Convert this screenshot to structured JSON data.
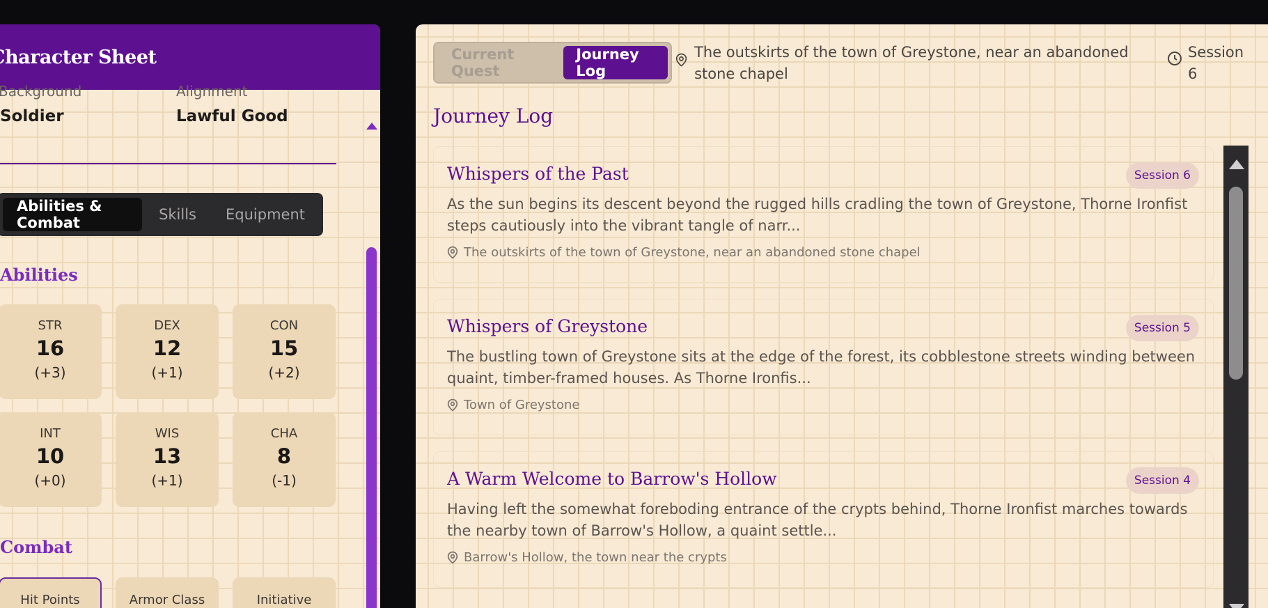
{
  "character_sheet": {
    "title": "Character Sheet",
    "background_label": "Background",
    "background_value": "Soldier",
    "alignment_label": "Alignment",
    "alignment_value": "Lawful Good",
    "tabs": [
      "Abilities & Combat",
      "Skills",
      "Equipment"
    ],
    "abilities_title": "Abilities",
    "abilities": [
      {
        "name": "STR",
        "score": "16",
        "mod": "(+3)"
      },
      {
        "name": "DEX",
        "score": "12",
        "mod": "(+1)"
      },
      {
        "name": "CON",
        "score": "15",
        "mod": "(+2)"
      },
      {
        "name": "INT",
        "score": "10",
        "mod": "(+0)"
      },
      {
        "name": "WIS",
        "score": "13",
        "mod": "(+1)"
      },
      {
        "name": "CHA",
        "score": "8",
        "mod": "(-1)"
      }
    ],
    "combat_title": "Combat",
    "combat": [
      "Hit Points",
      "Armor Class",
      "Initiative"
    ]
  },
  "journey": {
    "tabs": [
      "Current Quest",
      "Journey Log"
    ],
    "location": "The outskirts of the town of Greystone, near an abandoned stone chapel",
    "session": "Session 6",
    "log_title": "Journey Log",
    "entries": [
      {
        "title": "Whispers of the Past",
        "badge": "Session 6",
        "text": "As the sun begins its descent beyond the rugged hills cradling the town of Greystone, Thorne Ironfist steps cautiously into the vibrant tangle of narr...",
        "location": "The outskirts of the town of Greystone, near an abandoned stone chapel"
      },
      {
        "title": "Whispers of Greystone",
        "badge": "Session 5",
        "text": "The bustling town of Greystone sits at the edge of the forest, its cobblestone streets winding between quaint, timber-framed houses. As Thorne Ironfis...",
        "location": "Town of Greystone"
      },
      {
        "title": "A Warm Welcome to Barrow's Hollow",
        "badge": "Session 4",
        "text": "Having left the somewhat foreboding entrance of the crypts behind, Thorne Ironfist marches towards the nearby town of Barrow's Hollow, a quaint settle...",
        "location": "Barrow's Hollow, the town near the crypts"
      }
    ]
  },
  "colors": {
    "accent": "#5d1190",
    "parchment": "#f8ead4",
    "card": "#ecd7b6"
  }
}
